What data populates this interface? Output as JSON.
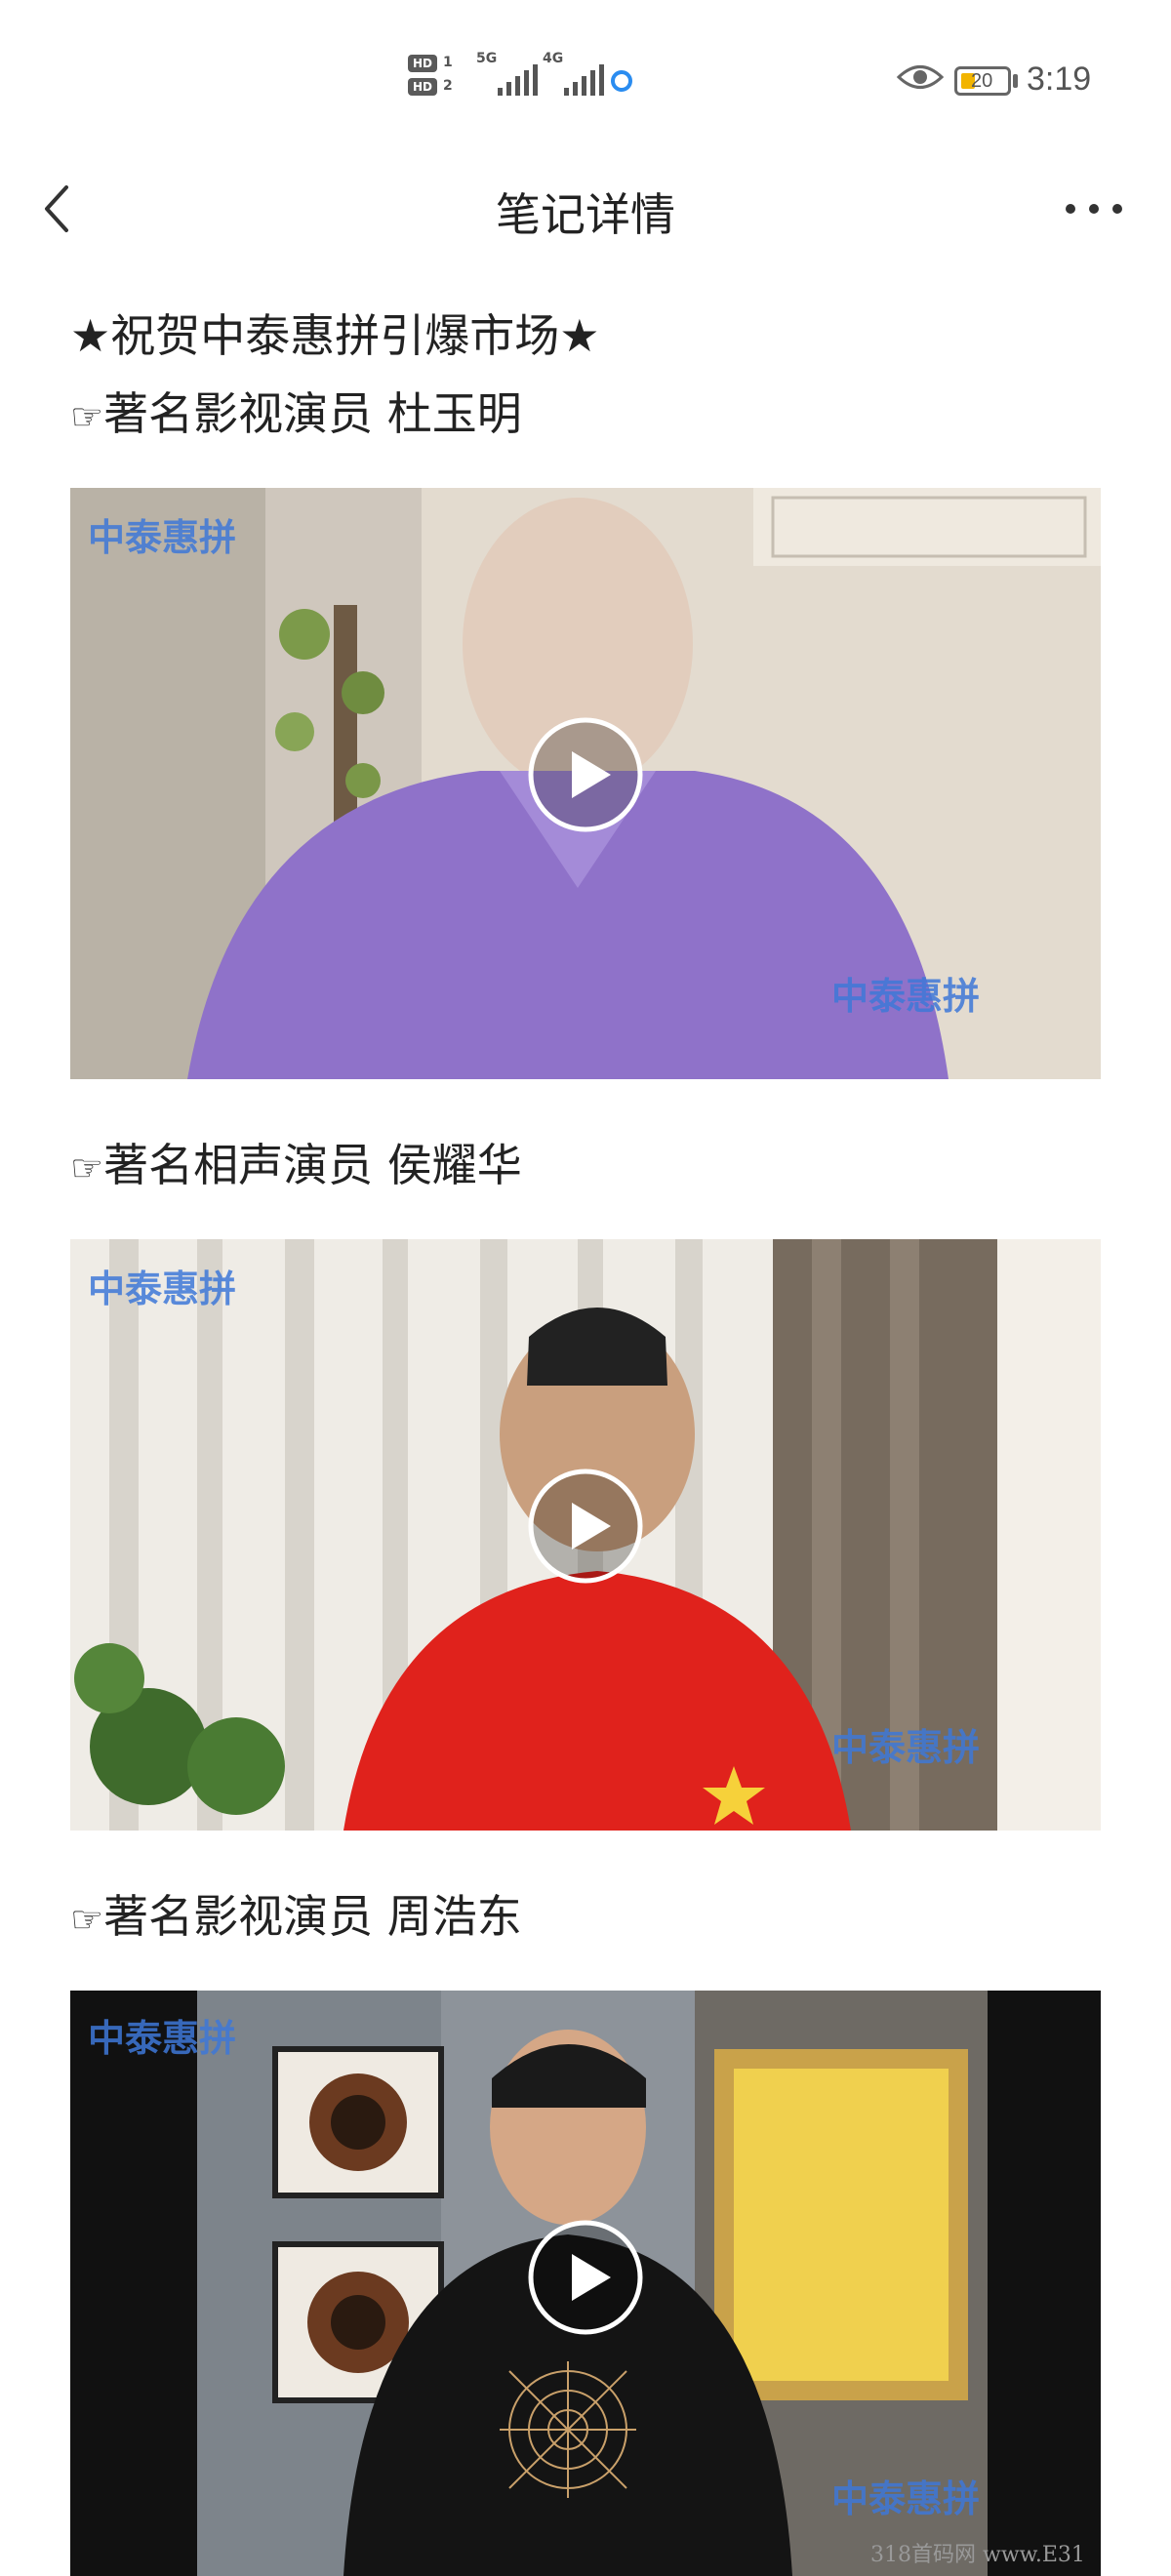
{
  "status_bar": {
    "sim1": "HD",
    "sim1_slot": "1",
    "sim2": "HD",
    "sim2_slot": "2",
    "net1": "5G",
    "net2": "4G",
    "battery": "20",
    "time": "3:19"
  },
  "nav": {
    "title": "笔记详情",
    "back_icon": "chevron-left-icon",
    "more_icon": "more-horizontal-icon"
  },
  "article": {
    "headline": "★祝贺中泰惠拼引爆市场★",
    "hand_glyph": "☞",
    "sections": [
      {
        "caption": "著名影视演员 杜玉明",
        "watermark": "中泰惠拼"
      },
      {
        "caption": "著名相声演员 侯耀华",
        "watermark": "中泰惠拼"
      },
      {
        "caption": "著名影视演员 周浩东",
        "watermark": "中泰惠拼"
      }
    ]
  },
  "footer_watermark": "318首码网 www.E31",
  "colors": {
    "accent": "#3e78d8",
    "battery_fill": "#f2b400"
  }
}
